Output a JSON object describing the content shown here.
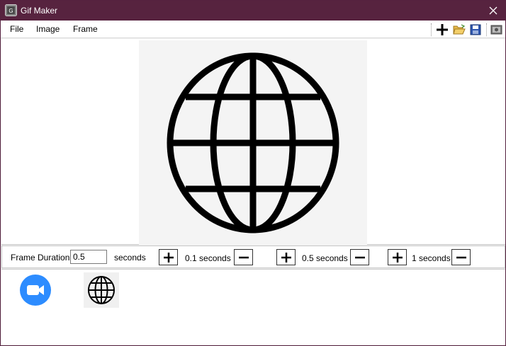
{
  "window": {
    "title": "Gif Maker",
    "titlebar_color": "#57233f"
  },
  "menu": {
    "items": [
      {
        "label": "File"
      },
      {
        "label": "Image"
      },
      {
        "label": "Frame"
      }
    ]
  },
  "toolbar": {
    "icons": [
      "add-icon",
      "open-folder-icon",
      "save-icon",
      "export-icon"
    ]
  },
  "preview": {
    "image": "globe-icon"
  },
  "duration": {
    "label": "Frame Duration",
    "value": "0.5",
    "unit": "seconds",
    "steps": [
      {
        "label": "0.1 seconds"
      },
      {
        "label": "0.5 seconds"
      },
      {
        "label": "1 seconds"
      }
    ]
  },
  "frames": {
    "items": [
      {
        "icon": "video-camera-icon",
        "accent": "#2d8cff"
      },
      {
        "icon": "globe-icon"
      }
    ]
  }
}
